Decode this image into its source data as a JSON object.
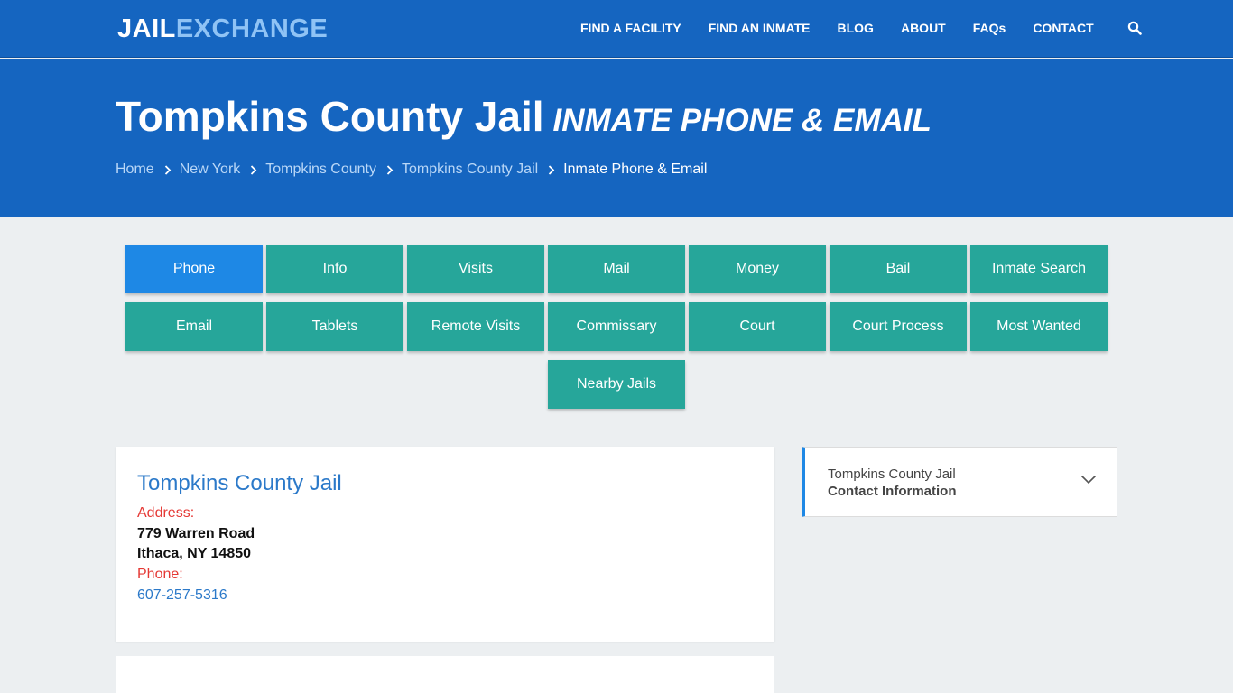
{
  "header": {
    "logo_part1": "JAIL",
    "logo_part2": "EXCHANGE",
    "nav": [
      "FIND A FACILITY",
      "FIND AN INMATE",
      "BLOG",
      "ABOUT",
      "FAQs",
      "CONTACT"
    ]
  },
  "hero": {
    "title": "Tompkins County Jail",
    "subtitle": "INMATE PHONE & EMAIL",
    "breadcrumb": [
      "Home",
      "New York",
      "Tompkins County",
      "Tompkins County Jail",
      "Inmate Phone & Email"
    ]
  },
  "tabs": {
    "row1": [
      "Phone",
      "Info",
      "Visits",
      "Mail",
      "Money",
      "Bail",
      "Inmate Search"
    ],
    "row2": [
      "Email",
      "Tablets",
      "Remote Visits",
      "Commissary",
      "Court",
      "Court Process",
      "Most Wanted"
    ],
    "row3": [
      "Nearby Jails"
    ]
  },
  "facility": {
    "name": "Tompkins County Jail",
    "address_label": "Address:",
    "street": "779 Warren Road",
    "city_state_zip": "Ithaca, NY 14850",
    "phone_label": "Phone:",
    "phone": "607-257-5316"
  },
  "sidebar": {
    "line1": "Tompkins County Jail",
    "line2": "Contact Information"
  },
  "colors": {
    "header_bg": "#1565c0",
    "tab_bg": "#26a69a",
    "tab_active": "#1e88e5",
    "label_red": "#e53935",
    "link_blue": "#2b79c9"
  },
  "icons": [
    "search-icon",
    "chevron-right-icon",
    "chevron-down-icon"
  ]
}
